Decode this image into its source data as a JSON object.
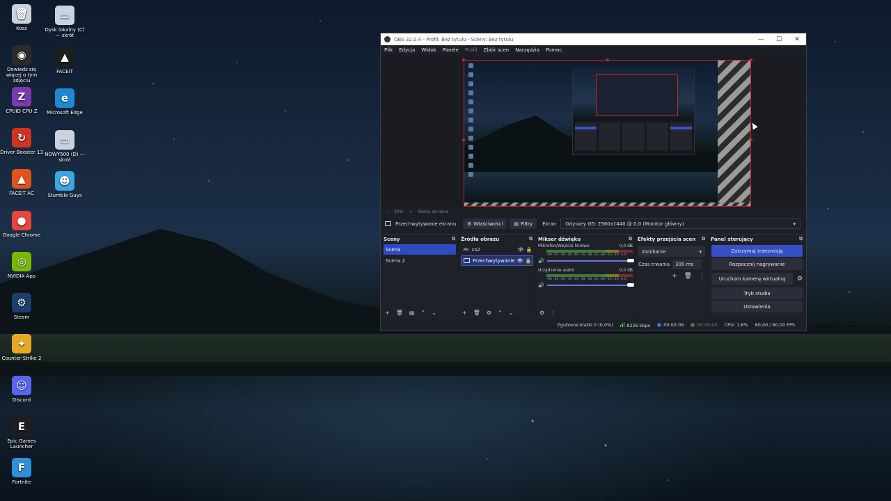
{
  "desktop": {
    "icons_col1": [
      {
        "label": "Kosz",
        "icon": "recycle-bin-icon",
        "glyph": "🗑",
        "color": "#c9d3de"
      },
      {
        "label": "Dowiedz się więcej o tym zdjęciu",
        "icon": "camera-info-icon",
        "glyph": "◉",
        "color": "#2b2b2b"
      },
      {
        "label": "CPUID CPU-Z",
        "icon": "cpuz-icon",
        "glyph": "Z",
        "color": "#7a3ab0"
      },
      {
        "label": "Driver Booster 13",
        "icon": "driver-booster-icon",
        "glyph": "↻",
        "color": "#d0331f"
      },
      {
        "label": "FACEIT AC",
        "icon": "faceit-ac-icon",
        "glyph": "▲",
        "color": "#e0541b"
      },
      {
        "label": "Google Chrome",
        "icon": "chrome-icon",
        "glyph": "●",
        "color": "#e8453c"
      },
      {
        "label": "NVIDIA App",
        "icon": "nvidia-icon",
        "glyph": "◎",
        "color": "#76b900"
      },
      {
        "label": "Steam",
        "icon": "steam-icon",
        "glyph": "⚙",
        "color": "#1b3e6b"
      },
      {
        "label": "Counter-Strike 2",
        "icon": "cs2-icon",
        "glyph": "✦",
        "color": "#e8a824"
      },
      {
        "label": "Discord",
        "icon": "discord-icon",
        "glyph": "☺",
        "color": "#5865f2"
      },
      {
        "label": "Epic Games Launcher",
        "icon": "epic-games-icon",
        "glyph": "E",
        "color": "#1e1e1e"
      },
      {
        "label": "Fortnite",
        "icon": "fortnite-icon",
        "glyph": "F",
        "color": "#2f8fd9"
      }
    ],
    "icons_col2": [
      {
        "label": "Dysk lokalny (C) — skrót",
        "icon": "drive-c-icon",
        "glyph": "▭",
        "color": "#c9d3de"
      },
      {
        "label": "FACEIT",
        "icon": "faceit-icon",
        "glyph": "▲",
        "color": "#1e1e1e"
      },
      {
        "label": "Microsoft Edge",
        "icon": "edge-icon",
        "glyph": "e",
        "color": "#1f88d0"
      },
      {
        "label": "NOWY500 (D) — skrót",
        "icon": "drive-d-icon",
        "glyph": "▭",
        "color": "#c9d3de"
      },
      {
        "label": "Stumble Guys",
        "icon": "stumble-guys-icon",
        "glyph": "☻",
        "color": "#3aa7e0"
      }
    ]
  },
  "obs": {
    "title": "OBS 32.0.4 - Profil: Bez tytułu - Sceny: Bez tytułu",
    "menu": [
      "Plik",
      "Edycja",
      "Widok",
      "Panele",
      "Profil",
      "Zbiór scen",
      "Narzędzia",
      "Pomoc"
    ],
    "zoom": {
      "minus": "−",
      "percent": "30%",
      "plus": "+",
      "fit": "Skaluj do okna"
    },
    "source_bar": {
      "source_name": "Przechwytywanie ekranu",
      "properties": "Właściwości",
      "filters": "Filtry",
      "screen_label": "Ekran",
      "screen_value": "Odyssey G5: 2560x1440 @ 0,0 (Monitor główny)"
    },
    "scenes": {
      "title": "Sceny",
      "items": [
        "Scena",
        "Scena 2"
      ]
    },
    "sources": {
      "title": "Źródła obrazu",
      "items": [
        "cs2",
        "Przechwytywanie"
      ]
    },
    "mixer": {
      "title": "Mikser dźwięku",
      "channels": [
        {
          "name": "Mikrofon/Wejście liniowe",
          "db": "0,0 dB"
        },
        {
          "name": "Urządzenie audio",
          "db": "0,0 dB"
        }
      ],
      "scale": "-60 -55 -50 -45 -40 -35 -30 -25 -20 -15 -10 -5 0"
    },
    "transitions": {
      "title": "Efekty przejścia scen",
      "selected": "Zanikanie",
      "duration_label": "Czas trwania",
      "duration_value": "300 ms"
    },
    "controls": {
      "title": "Panel sterujący",
      "stop_stream": "Zatrzymaj transmisję",
      "start_recording": "Rozpocznij nagrywanie",
      "virtual_camera": "Uruchom kamerę wirtualną",
      "studio_mode": "Tryb studia",
      "settings": "Ustawienia"
    },
    "status": {
      "dropped": "Zgubione klatki 0 (0,0%)",
      "bitrate": "8226 kbps",
      "stream_time": "00:02:09",
      "rec_time": "00:00:00",
      "cpu": "CPU: 1,6%",
      "fps": "60,00 / 60,00 FPS"
    },
    "colors": {
      "accent": "#3650c8",
      "selection_border": "#d0232a",
      "live": "#46c34b"
    }
  }
}
